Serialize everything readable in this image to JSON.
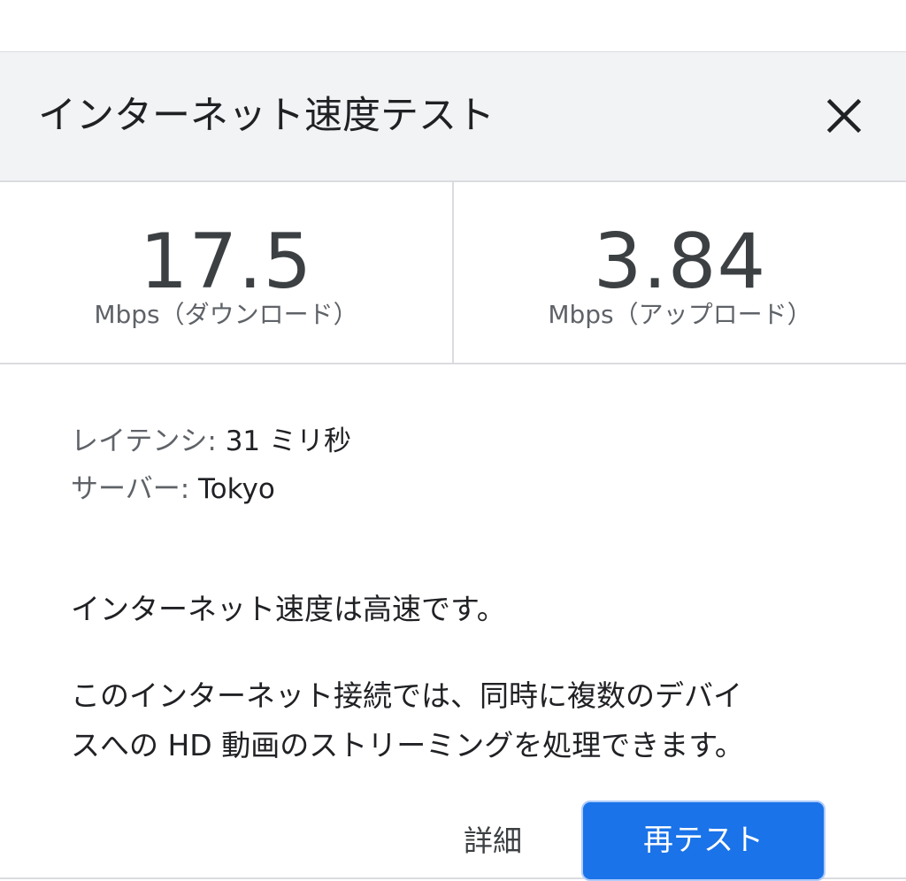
{
  "dialog": {
    "title": "インターネット速度テスト",
    "close_icon": "close-icon"
  },
  "download": {
    "value": "17.5",
    "unit_label": "Mbps（ダウンロード）"
  },
  "upload": {
    "value": "3.84",
    "unit_label": "Mbps（アップロード）"
  },
  "latency": {
    "label": "レイテンシ:",
    "value": "31 ミリ秒"
  },
  "server": {
    "label": "サーバー:",
    "value": "Tokyo"
  },
  "summary": "インターネット速度は高速です。",
  "description_lines": [
    "このインターネット接続では、同時に複数のデバイ",
    "スへの HD 動画のストリーミングを処理できます。"
  ],
  "actions": {
    "details_label": "詳細",
    "retest_label": "再テスト"
  },
  "colors": {
    "header_bg": "#f1f3f4",
    "primary": "#1a73e8",
    "divider": "#dadce0"
  }
}
